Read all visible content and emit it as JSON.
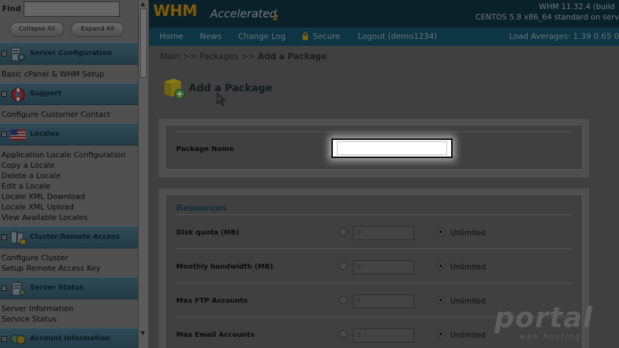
{
  "sidebar": {
    "find_label": "Find",
    "collapse_label": "Collapse All",
    "expand_label": "Expand All",
    "sections": [
      {
        "title": "Server Configuration",
        "links": [
          "Basic cPanel & WHM Setup"
        ]
      },
      {
        "title": "Support",
        "links": [
          "Configure Customer Contact"
        ]
      },
      {
        "title": "Locales",
        "links": [
          "Application Locale Configuration",
          "Copy a Locale",
          "Delete a Locale",
          "Edit a Locale",
          "Locale XML Download",
          "Locale XML Upload",
          "View Available Locales"
        ]
      },
      {
        "title": "Cluster/Remote Access",
        "links": [
          "Configure Cluster",
          "Setup Remote Access Key"
        ]
      },
      {
        "title": "Server Status",
        "links": [
          "Server Information",
          "Service Status"
        ]
      },
      {
        "title": "Account Information",
        "links": []
      }
    ]
  },
  "header": {
    "logo_main": "WHM",
    "logo_accent": "Accelerated",
    "logo_version": "2",
    "version_line1": "WHM 11.32.4 (build",
    "version_line2": "CENTOS 5.8 x86_64 standard on serv"
  },
  "nav": {
    "items": [
      "Home",
      "News",
      "Change Log",
      "Secure",
      "Logout (demo1234)"
    ],
    "load_averages": "Load Averages: 1.39 0.65 0"
  },
  "breadcrumb": {
    "path": "Main >> Packages >> ",
    "current": "Add a Package"
  },
  "page": {
    "title": "Add a Package"
  },
  "form": {
    "package_name_label": "Package Name",
    "package_name_value": ""
  },
  "resources": {
    "title": "Resources",
    "rows": [
      {
        "label": "Disk quota (MB)",
        "value": "0",
        "unlimited_label": "Unlimited",
        "unlimited_selected": true
      },
      {
        "label": "Monthly bandwidth (MB)",
        "value": "0",
        "unlimited_label": "Unlimited",
        "unlimited_selected": true
      },
      {
        "label": "Max FTP Accounts",
        "value": "0",
        "unlimited_label": "Unlimited",
        "unlimited_selected": true
      },
      {
        "label": "Max Email Accounts",
        "value": "0",
        "unlimited_label": "Unlimited",
        "unlimited_selected": true
      }
    ]
  },
  "watermark": {
    "text": "portal",
    "sub": "web hosting"
  },
  "colors": {
    "header_bg": "#0b2129",
    "nav_bg": "#0d3544",
    "logo": "#7e5a0a",
    "section_bg": "#2f4a56"
  }
}
